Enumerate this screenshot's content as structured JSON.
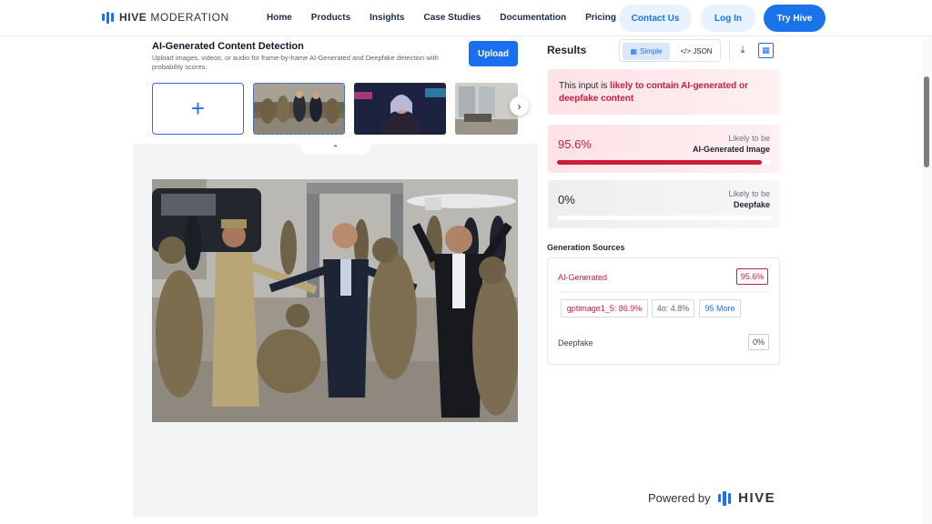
{
  "nav": {
    "brand_bold": "HIVE",
    "brand_rest": " MODERATION",
    "links": [
      "Home",
      "Products",
      "Insights",
      "Case Studies",
      "Documentation",
      "Pricing"
    ],
    "contact": "Contact Us",
    "login": "Log In",
    "try": "Try Hive",
    "accent_color": "#1a73e8"
  },
  "detector": {
    "title": "AI-Generated Content Detection",
    "subtitle": "Upload images, videos, or audio for frame-by-frame AI-Generated and Deepfake detection with probability scores.",
    "upload_label": "Upload",
    "add_symbol": "+",
    "thumbnails": [
      "soldiers-scene",
      "neon-woman",
      "interior-room"
    ]
  },
  "results": {
    "title": "Results",
    "view_simple": "Simple",
    "view_json": "</> JSON",
    "verdict_prefix": "This input is ",
    "verdict_highlight": "likely to contain AI-generated or deepfake content",
    "ai_card": {
      "percent": "95.6%",
      "value": 0.956,
      "label_small": "Likely to be",
      "label_big": "AI-Generated Image"
    },
    "deepfake_card": {
      "percent": "0%",
      "value": 0,
      "label_small": "Likely to be",
      "label_big": "Deepfake"
    },
    "alert_color": "#c81e3a"
  },
  "sources": {
    "title": "Generation Sources",
    "ai_label": "AI-Generated",
    "ai_percent": "95.6%",
    "chips": [
      "gptimage1_5: 86.9%",
      "4o: 4.8%",
      "95 More"
    ],
    "deepfake_label": "Deepfake",
    "deepfake_percent": "0%"
  },
  "footer": {
    "powered": "Powered by",
    "hive": "HIVE"
  }
}
